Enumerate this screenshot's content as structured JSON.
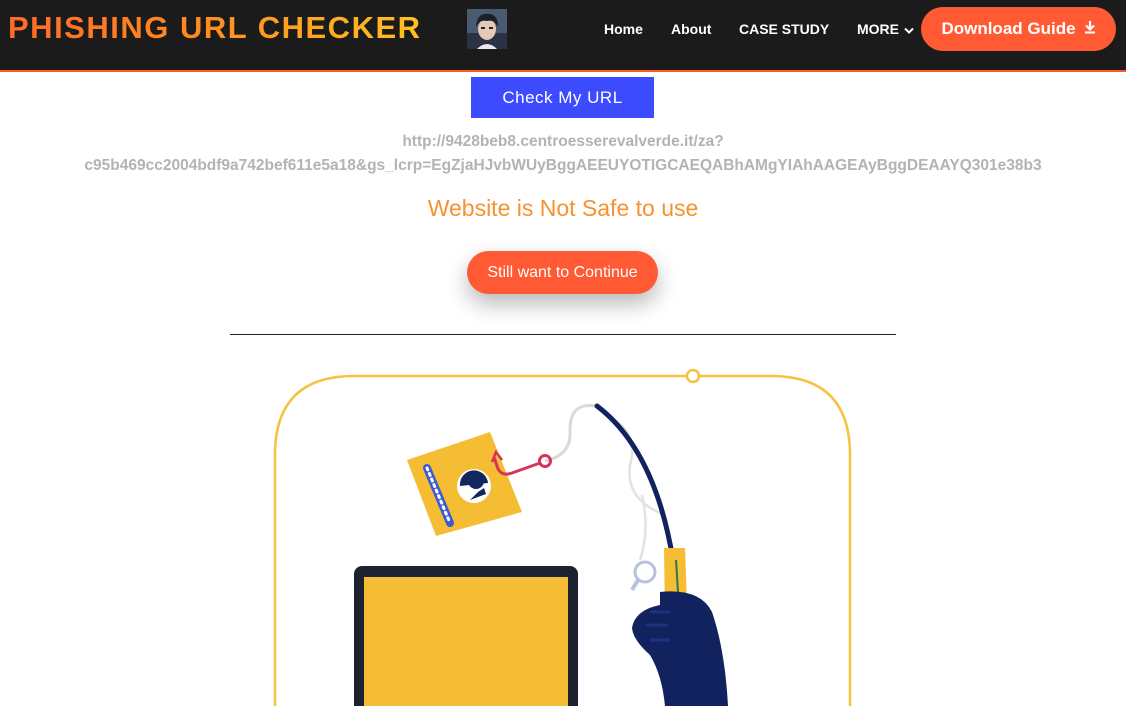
{
  "header": {
    "brand": "PHISHING URL CHECKER",
    "nav": [
      "Home",
      "About",
      "CASE STUDY",
      "MORE"
    ],
    "download_label": "Download Guide",
    "colors": {
      "bar": "#1b1b1b",
      "accent": "#ff5a33"
    }
  },
  "checker": {
    "button_label": "Check My URL",
    "url_line1": "http://9428beb8.centroesserevalverde.it/za?",
    "url_line2": "c95b469cc2004bdf9a742bef611e5a18&gs_lcrp=EgZjaHJvbWUyBggAEEUYOTIGCAEQABhAMgYIAhAAGEAyBggDEAAYQ301e38b3",
    "status": "Website is Not Safe to use",
    "status_color": "#f7922e",
    "continue_label": "Still want to Continue"
  },
  "illustration": {
    "subject": "phishing hook with id card above a laptop",
    "icons": [
      "fishing-rod-icon",
      "id-card-icon",
      "laptop-icon",
      "glove-hand-icon"
    ]
  }
}
